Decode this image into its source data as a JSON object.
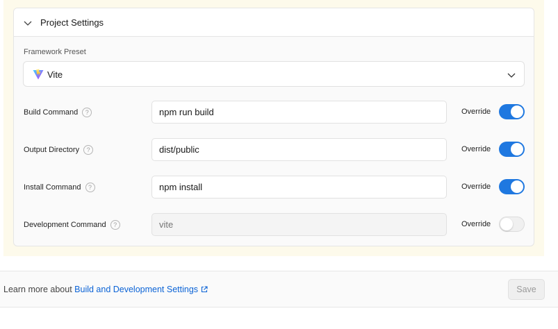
{
  "project_settings": {
    "title": "Project Settings",
    "framework_preset": {
      "label": "Framework Preset",
      "value": "Vite",
      "icon": "vite-logo-icon"
    },
    "rows": [
      {
        "label": "Build Command",
        "value": "npm run build",
        "placeholder": "",
        "override_label": "Override",
        "override": true
      },
      {
        "label": "Output Directory",
        "value": "dist/public",
        "placeholder": "",
        "override_label": "Override",
        "override": true
      },
      {
        "label": "Install Command",
        "value": "npm install",
        "placeholder": "",
        "override_label": "Override",
        "override": true
      },
      {
        "label": "Development Command",
        "value": "",
        "placeholder": "vite",
        "override_label": "Override",
        "override": false
      }
    ]
  },
  "footer": {
    "text": "Learn more about ",
    "link": "Build and Development Settings",
    "save_label": "Save"
  },
  "colors": {
    "accent": "#1f78e0",
    "link": "#0b63d6",
    "highlight_frame": "#fdfaeb"
  }
}
